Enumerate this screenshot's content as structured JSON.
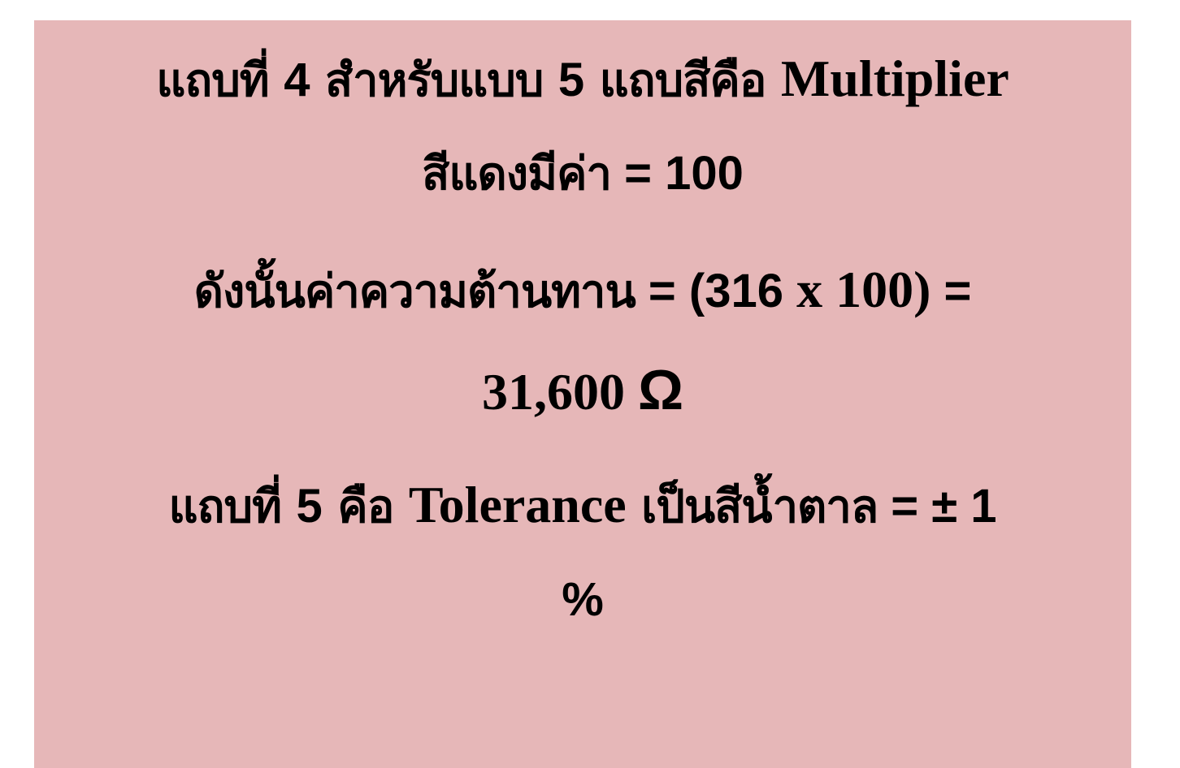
{
  "slide": {
    "background_color": "#e6b7b8",
    "line1": {
      "thai_a": "แถบที่ ",
      "num_a": "4",
      "thai_b": " สำหรับแบบ ",
      "num_b": "5",
      "thai_c": " แถบสีคือ ",
      "latin": "Multiplier"
    },
    "line2": {
      "thai": "สีแดงมีค่า",
      "rest": " = 100"
    },
    "line3": {
      "thai": "ดังนั้นค่าความต้านทาน",
      "eq": " = (316 ",
      "times": "x",
      "val": " 100)",
      "eq_end": " ="
    },
    "line4": {
      "value": "31,600 ",
      "unit": "Ω"
    },
    "line5": {
      "thai_a": "แถบที่ ",
      "num": "5",
      "thai_b": " คือ ",
      "latin": "Tolerance",
      "thai_c": " เป็นสีน้ำตาล",
      "rest": " = ± 1"
    },
    "line6": {
      "text": "%"
    }
  }
}
